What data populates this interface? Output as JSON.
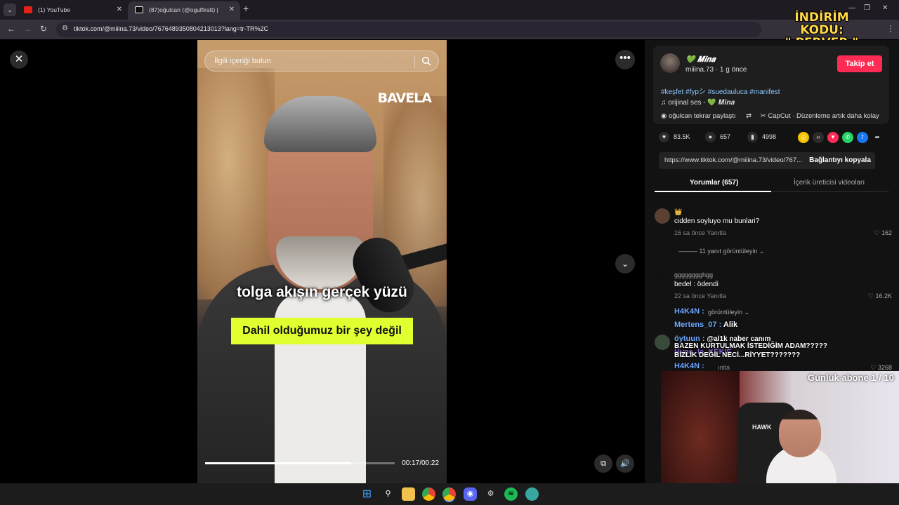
{
  "browser": {
    "tabs": [
      {
        "label": "(1) YouTube",
        "icon": "youtube-icon"
      },
      {
        "label": "(87)oğulcan (@ogulfiratt) |",
        "icon": "tiktok-icon"
      }
    ],
    "url": "tiktok.com/@miiina.73/video/7676489350804213013?lang=tr-TR%2C",
    "promo_line1": "İNDİRİM KODU:",
    "promo_line2": "\" PERVER \""
  },
  "video": {
    "search_placeholder": "İlgili içeriği bulun",
    "brand": "BAVELA",
    "caption_top": "tolga akışın gerçek yüzü",
    "caption_box": "Dahil olduğumuz bir şey değil",
    "time": "00:17/00:22",
    "progress_fraction": 0.77
  },
  "post": {
    "display_name": "𝑴𝒊𝒏𝒂",
    "handle_line": "miiina.73 · 1 g önce",
    "follow_label": "Takip et",
    "hashtags": "#keşfet #fypシ #suedauluca #manifest",
    "sound": "orijinal ses - 💚 𝑴𝒊𝒏𝒂",
    "repost": "oğulcan tekrar paylaştı",
    "capcut": "CapCut · Düzenleme artık daha kolay",
    "likes": "83.5K",
    "comments": "657",
    "saves": "4998",
    "link": "https://www.tiktok.com/@miiina.73/video/767...",
    "copy_label": "Bağlantıyı kopyala",
    "tab_comments": "Yorumlar (657)",
    "tab_creator": "İçerik üreticisi videoları"
  },
  "comments": [
    {
      "name": "👑",
      "text": "cidden soyluyo mu bunlari?",
      "meta": "16 sa önce    Yanıtla",
      "likes": "162",
      "replies": "11 yanıt görüntüleyin"
    },
    {
      "name": "gggggggghgg",
      "text": "bedel : ödendi",
      "meta": "22 sa önce    Yanıtla",
      "likes": "16.2K",
      "replies": "görüntüleyin"
    },
    {
      "name": "",
      "text": "",
      "meta": "ıntla",
      "likes": "3268",
      "replies": ""
    }
  ],
  "chat": [
    {
      "user": "H4K4N :",
      "msg": ""
    },
    {
      "user": "Mertens_07 :",
      "msg": "Alik"
    },
    {
      "user": "öytuun :",
      "msg": "@al1k naber canım"
    },
    {
      "user": "Hype_le_KEKIE",
      "msg": ""
    },
    {
      "user": "H4K4N :",
      "msg": ""
    }
  ],
  "overlay_lines": [
    "BAZEN KURTULMAK İSTEDİĞİM ADAM?????",
    "BİZLİK DEĞİL NECİ...RİYYET???????"
  ],
  "stream": {
    "sub_counter": "Günlük abone 1 / 10",
    "chair_logo": "HAWK"
  },
  "colors": {
    "accent": "#fe2c55",
    "caption_box": "#e2ff2f",
    "hashtag": "#8cc8ff"
  }
}
